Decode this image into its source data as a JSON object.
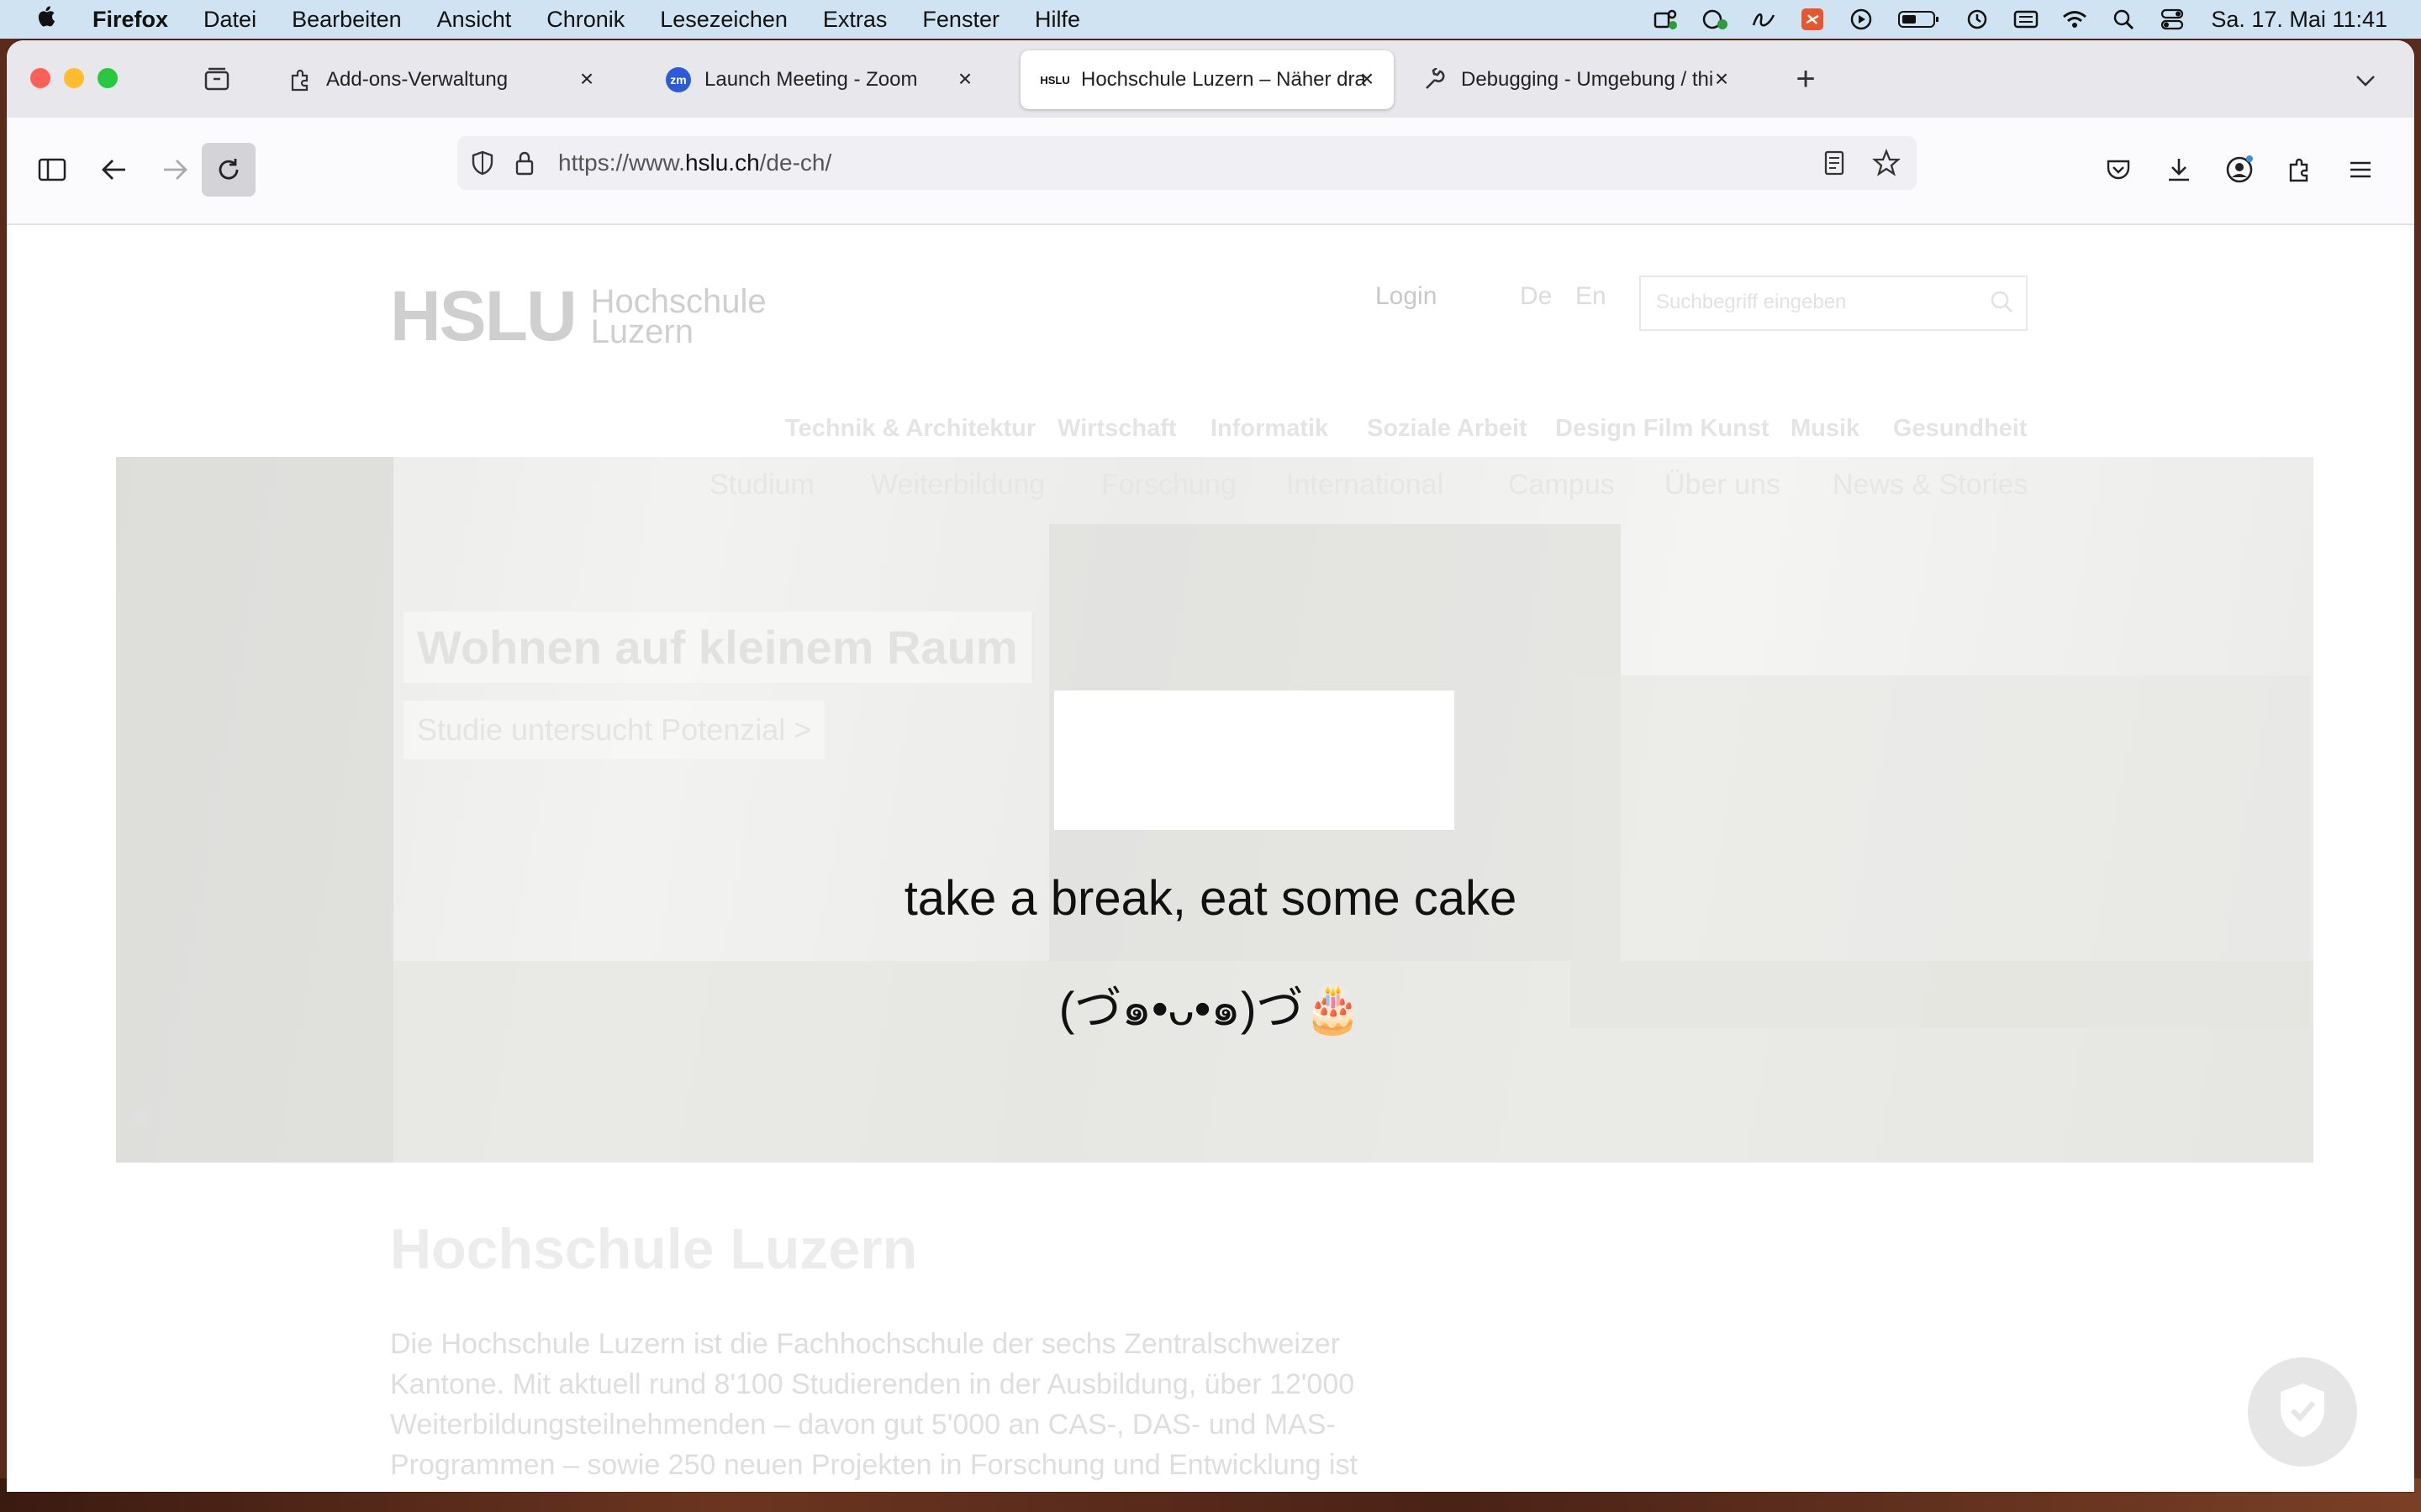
{
  "menubar": {
    "app": "Firefox",
    "items": [
      "Datei",
      "Bearbeiten",
      "Ansicht",
      "Chronik",
      "Lesezeichen",
      "Extras",
      "Fenster",
      "Hilfe"
    ],
    "clock": "Sa. 17. Mai  11:41"
  },
  "tabs": [
    {
      "label": "Add-ons-Verwaltung",
      "icon": "puzzle-icon"
    },
    {
      "label": "Launch Meeting - Zoom",
      "icon": "zoom-icon",
      "icon_text": "zm"
    },
    {
      "label": "Hochschule Luzern – Näher dran",
      "icon": "hslu-icon",
      "icon_text": "HSLU"
    },
    {
      "label": "Debugging - Umgebung / this-firefox",
      "icon": "wrench-icon"
    }
  ],
  "url": {
    "prefix": "https://www.",
    "domain": "hslu.ch",
    "path": "/de-ch/"
  },
  "site": {
    "logo_big": "HSLU",
    "logo_line1": "Hochschule",
    "logo_line2": "Luzern",
    "login": "Login",
    "lang_de": "De",
    "lang_en": "En",
    "search_placeholder": "Suchbegriff eingeben",
    "faculties": [
      "Technik & Architektur",
      "Wirtschaft",
      "Informatik",
      "Soziale Arbeit",
      "Design Film Kunst",
      "Musik",
      "Gesundheit"
    ],
    "nav": [
      "Studium",
      "Weiterbildung",
      "Forschung",
      "International",
      "Campus",
      "Über uns",
      "News & Stories"
    ],
    "hero_title": "Wohnen auf kleinem Raum",
    "hero_link": "Studie untersucht Potenzial >",
    "intro_title": "Hochschule Luzern",
    "intro_text": "Die Hochschule Luzern ist die Fachhochschule der sechs Zentralschweizer Kantone. Mit aktuell rund 8'100 Studierenden in der Ausbildung, über 12'000 Weiterbildungsteilnehmenden – davon gut 5'000 an CAS-, DAS- und MAS-Programmen – sowie 250 neuen Projekten in Forschung und Entwicklung ist sie die grösste Bildungsinstitution im Herzen der Schweiz."
  },
  "overlay": {
    "line1": "take a break, eat some cake",
    "line2": "(づ๑•ᴗ•๑)づ🎂"
  },
  "colors": {
    "menubar_bg": "#cfe3f2",
    "tabbar_bg": "#e8e8ec",
    "traffic_red": "#fe5f57",
    "traffic_yellow": "#febc2e",
    "traffic_green": "#28c840"
  }
}
